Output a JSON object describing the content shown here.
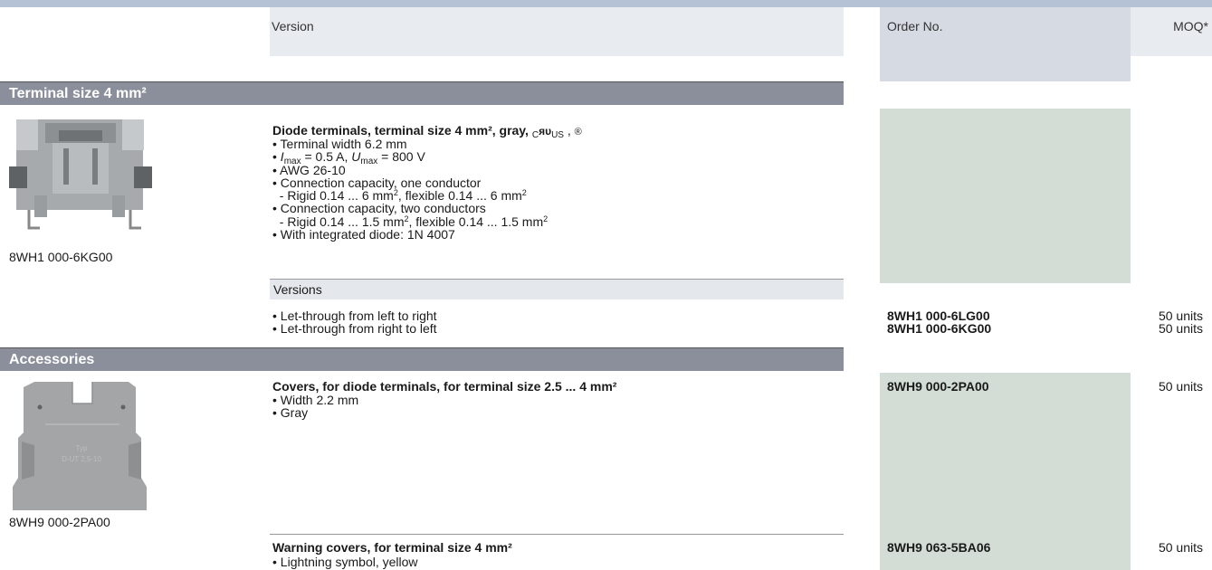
{
  "header": {
    "version": "Version",
    "order_no": "Order No.",
    "moq": "MOQ*"
  },
  "sections": {
    "terminal": "Terminal size 4 mm²",
    "accessories": "Accessories"
  },
  "diode": {
    "title_a": "Diode terminals, terminal size 4 mm², gray, ",
    "cert_c": "C",
    "cert_ru": "ᴙᴜ",
    "cert_us": "US",
    "cert_sep": " , ",
    "cert_csa": "®",
    "l1": "• Terminal width 6.2 mm",
    "l2_bullet": "• ",
    "l2_i": "I",
    "l2_max1": "max",
    "l2_mid": " = 0.5 A, ",
    "l2_u": "U",
    "l2_max2": "max",
    "l2_end": " = 800 V",
    "l3": "• AWG 26-10",
    "l4": "• Connection capacity, one conductor",
    "l5a": "  - Rigid 0.14 ... 6 mm",
    "l5b": "2",
    "l5c": ", flexible 0.14 ... 6 mm",
    "l5d": "2",
    "l6": "• Connection capacity, two conductors",
    "l7a": "  - Rigid 0.14 ... 1.5 mm",
    "l7b": "2",
    "l7c": ", flexible 0.14 ... 1.5 mm",
    "l7d": "2",
    "l8": "• With integrated diode: 1N 4007",
    "caption": "8WH1 000-6KG00",
    "versions_label": "Versions",
    "rows": [
      {
        "text": "• Let-through from left to right",
        "order": "8WH1 000-6LG00",
        "moq": "50 units"
      },
      {
        "text": "• Let-through from right to left",
        "order": "8WH1 000-6KG00",
        "moq": "50 units"
      }
    ]
  },
  "covers": {
    "title": "Covers, for diode terminals, for terminal size 2.5 ... 4 mm²",
    "l1": "• Width 2.2 mm",
    "l2": "• Gray",
    "order": "8WH9 000-2PA00",
    "moq": "50 units",
    "caption": "8WH9 000-2PA00",
    "img_text1": "Typ",
    "img_text2": "D-UT 2,5-10"
  },
  "warning": {
    "title": "Warning covers, for terminal size 4 mm²",
    "l1": "• Lightning symbol, yellow",
    "order": "8WH9 063-5BA06",
    "moq": "50 units"
  }
}
